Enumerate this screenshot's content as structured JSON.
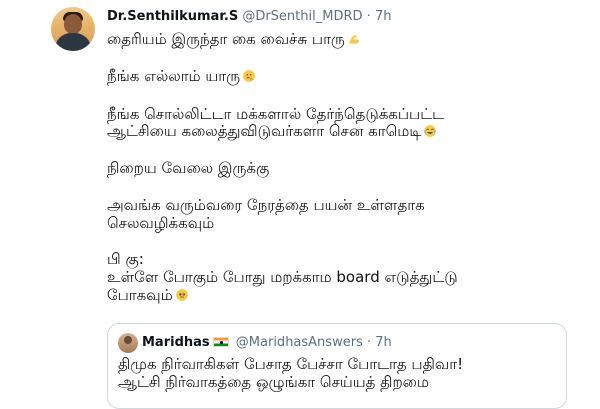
{
  "tweet": {
    "author": {
      "name": "Dr.Senthilkumar.S",
      "handle": "@DrSenthil_MDRD",
      "time": "7h"
    },
    "separator": "·",
    "lines": [
      "தைரியம் இருந்தா கை வைச்சு பாரு",
      "நீங்க எல்லாம் யாரு",
      "நீங்க சொல்லிட்டா மக்களால் தேர்ந்தெடுக்கப்பட்ட",
      "ஆட்சியை கலைத்துவிடுவர்களா சென காமெடி",
      "நிறைய வேலை இருக்கு",
      "அவங்க வரும்வரை  நேரத்தை பயன் உள்ளதாக",
      "செலவழிக்கவும்",
      "பி கு:",
      "உள்ளே போகும் போது மறக்காம board எடுத்துட்டு",
      "போகவும்"
    ],
    "emojis": {
      "line0": "flexed-biceps-icon",
      "line1": "thinking-face-icon",
      "line3": "face-with-tears-of-joy-icon",
      "line9": "pleading-face-icon"
    }
  },
  "quote": {
    "author": {
      "name": "Maridhas",
      "handle": "@MaridhasAnswers",
      "time": "7h"
    },
    "separator": "·",
    "flag_icon": "india-flag-icon",
    "lines": [
      "திமுக நிர்வாகிகள் பேசாத பேச்சா போடாத பதிவா!",
      "ஆட்சி நிர்வாகத்தை ஒழுங்கா செய்யத் திறமை"
    ]
  },
  "colors": {
    "text": "#0f1419",
    "secondary": "#5b7083",
    "border": "#cfd9de",
    "emoji_yellow": "#f7c948",
    "flag_saffron": "#ff9933",
    "flag_green": "#138808"
  }
}
